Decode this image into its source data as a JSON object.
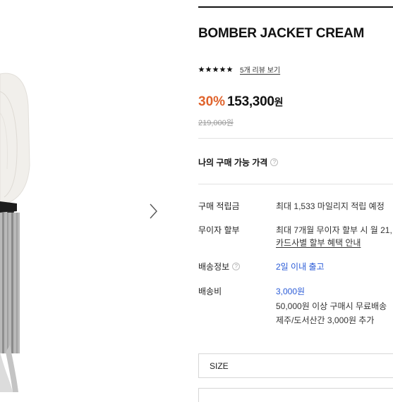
{
  "product": {
    "title": "BOMBER JACKET CREAM",
    "rating_stars": 5,
    "review_link": "5개 리뷰 보기",
    "discount": "30%",
    "sale_price": "153,300",
    "sale_unit": "원",
    "original_price": "219,000원"
  },
  "my_price": {
    "label": "나의 구매 가능 가격",
    "help_icon": "?"
  },
  "info": {
    "points_label": "구매 적립금",
    "points_value": "최대 1,533 마일리지 적립 예정",
    "installment_label": "무이자 할부",
    "installment_value": "최대 7개월 무이자 할부 시 월 21,",
    "installment_link": "카드사별 할부 혜택 안내",
    "shipping_info_label": "배송정보",
    "shipping_info_help": "?",
    "shipping_info_value": "2일 이내 출고",
    "shipping_fee_label": "배송비",
    "shipping_fee_value": "3,000원",
    "shipping_fee_free": "50,000원 이상 구매시 무료배송",
    "shipping_fee_island": "제주/도서산간 3,000원 추가"
  },
  "options": {
    "size_label": "SIZE"
  },
  "colors": {
    "discount": "#e0642d",
    "link_blue": "#2a5bd7"
  },
  "icons": {
    "next": "chevron-right-icon",
    "star": "star-icon",
    "help": "help-circle-icon"
  }
}
